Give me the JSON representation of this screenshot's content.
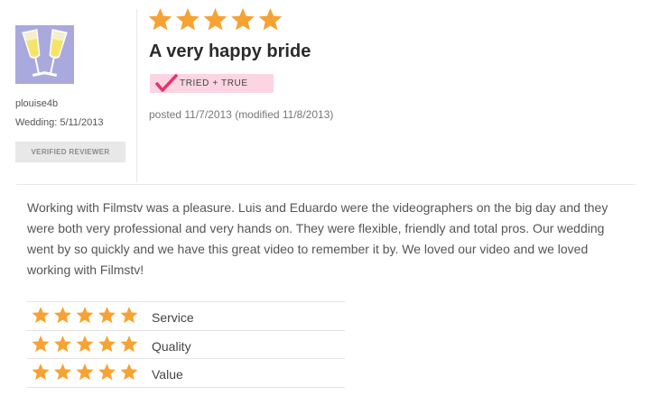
{
  "reviewer": {
    "name": "plouise4b",
    "wedding": "Wedding: 5/11/2013",
    "verified_badge": "VERIFIED REVIEWER",
    "avatar_icon": "champagne-glasses-icon"
  },
  "review": {
    "overall_rating": 5,
    "max_rating": 5,
    "title": "A very happy bride",
    "badge": "TRIED + TRUE",
    "posted": "posted 11/7/2013 (modified 11/8/2013)",
    "body": "Working with Filmstv was a pleasure. Luis and Eduardo were the videographers on the big day and they were both very professional and very hands on. They were flexible, friendly and total pros. Our wedding went by so quickly and we have this great video to remember it by. We loved our video and we loved working with Filmstv!"
  },
  "ratings": [
    {
      "label": "Service",
      "value": 5
    },
    {
      "label": "Quality",
      "value": 5
    },
    {
      "label": "Value",
      "value": 5
    }
  ],
  "colors": {
    "star": "#f7a232",
    "badge_bg": "#fcd4e2",
    "badge_check": "#e8336b",
    "avatar_bg": "#a9a9dd"
  }
}
